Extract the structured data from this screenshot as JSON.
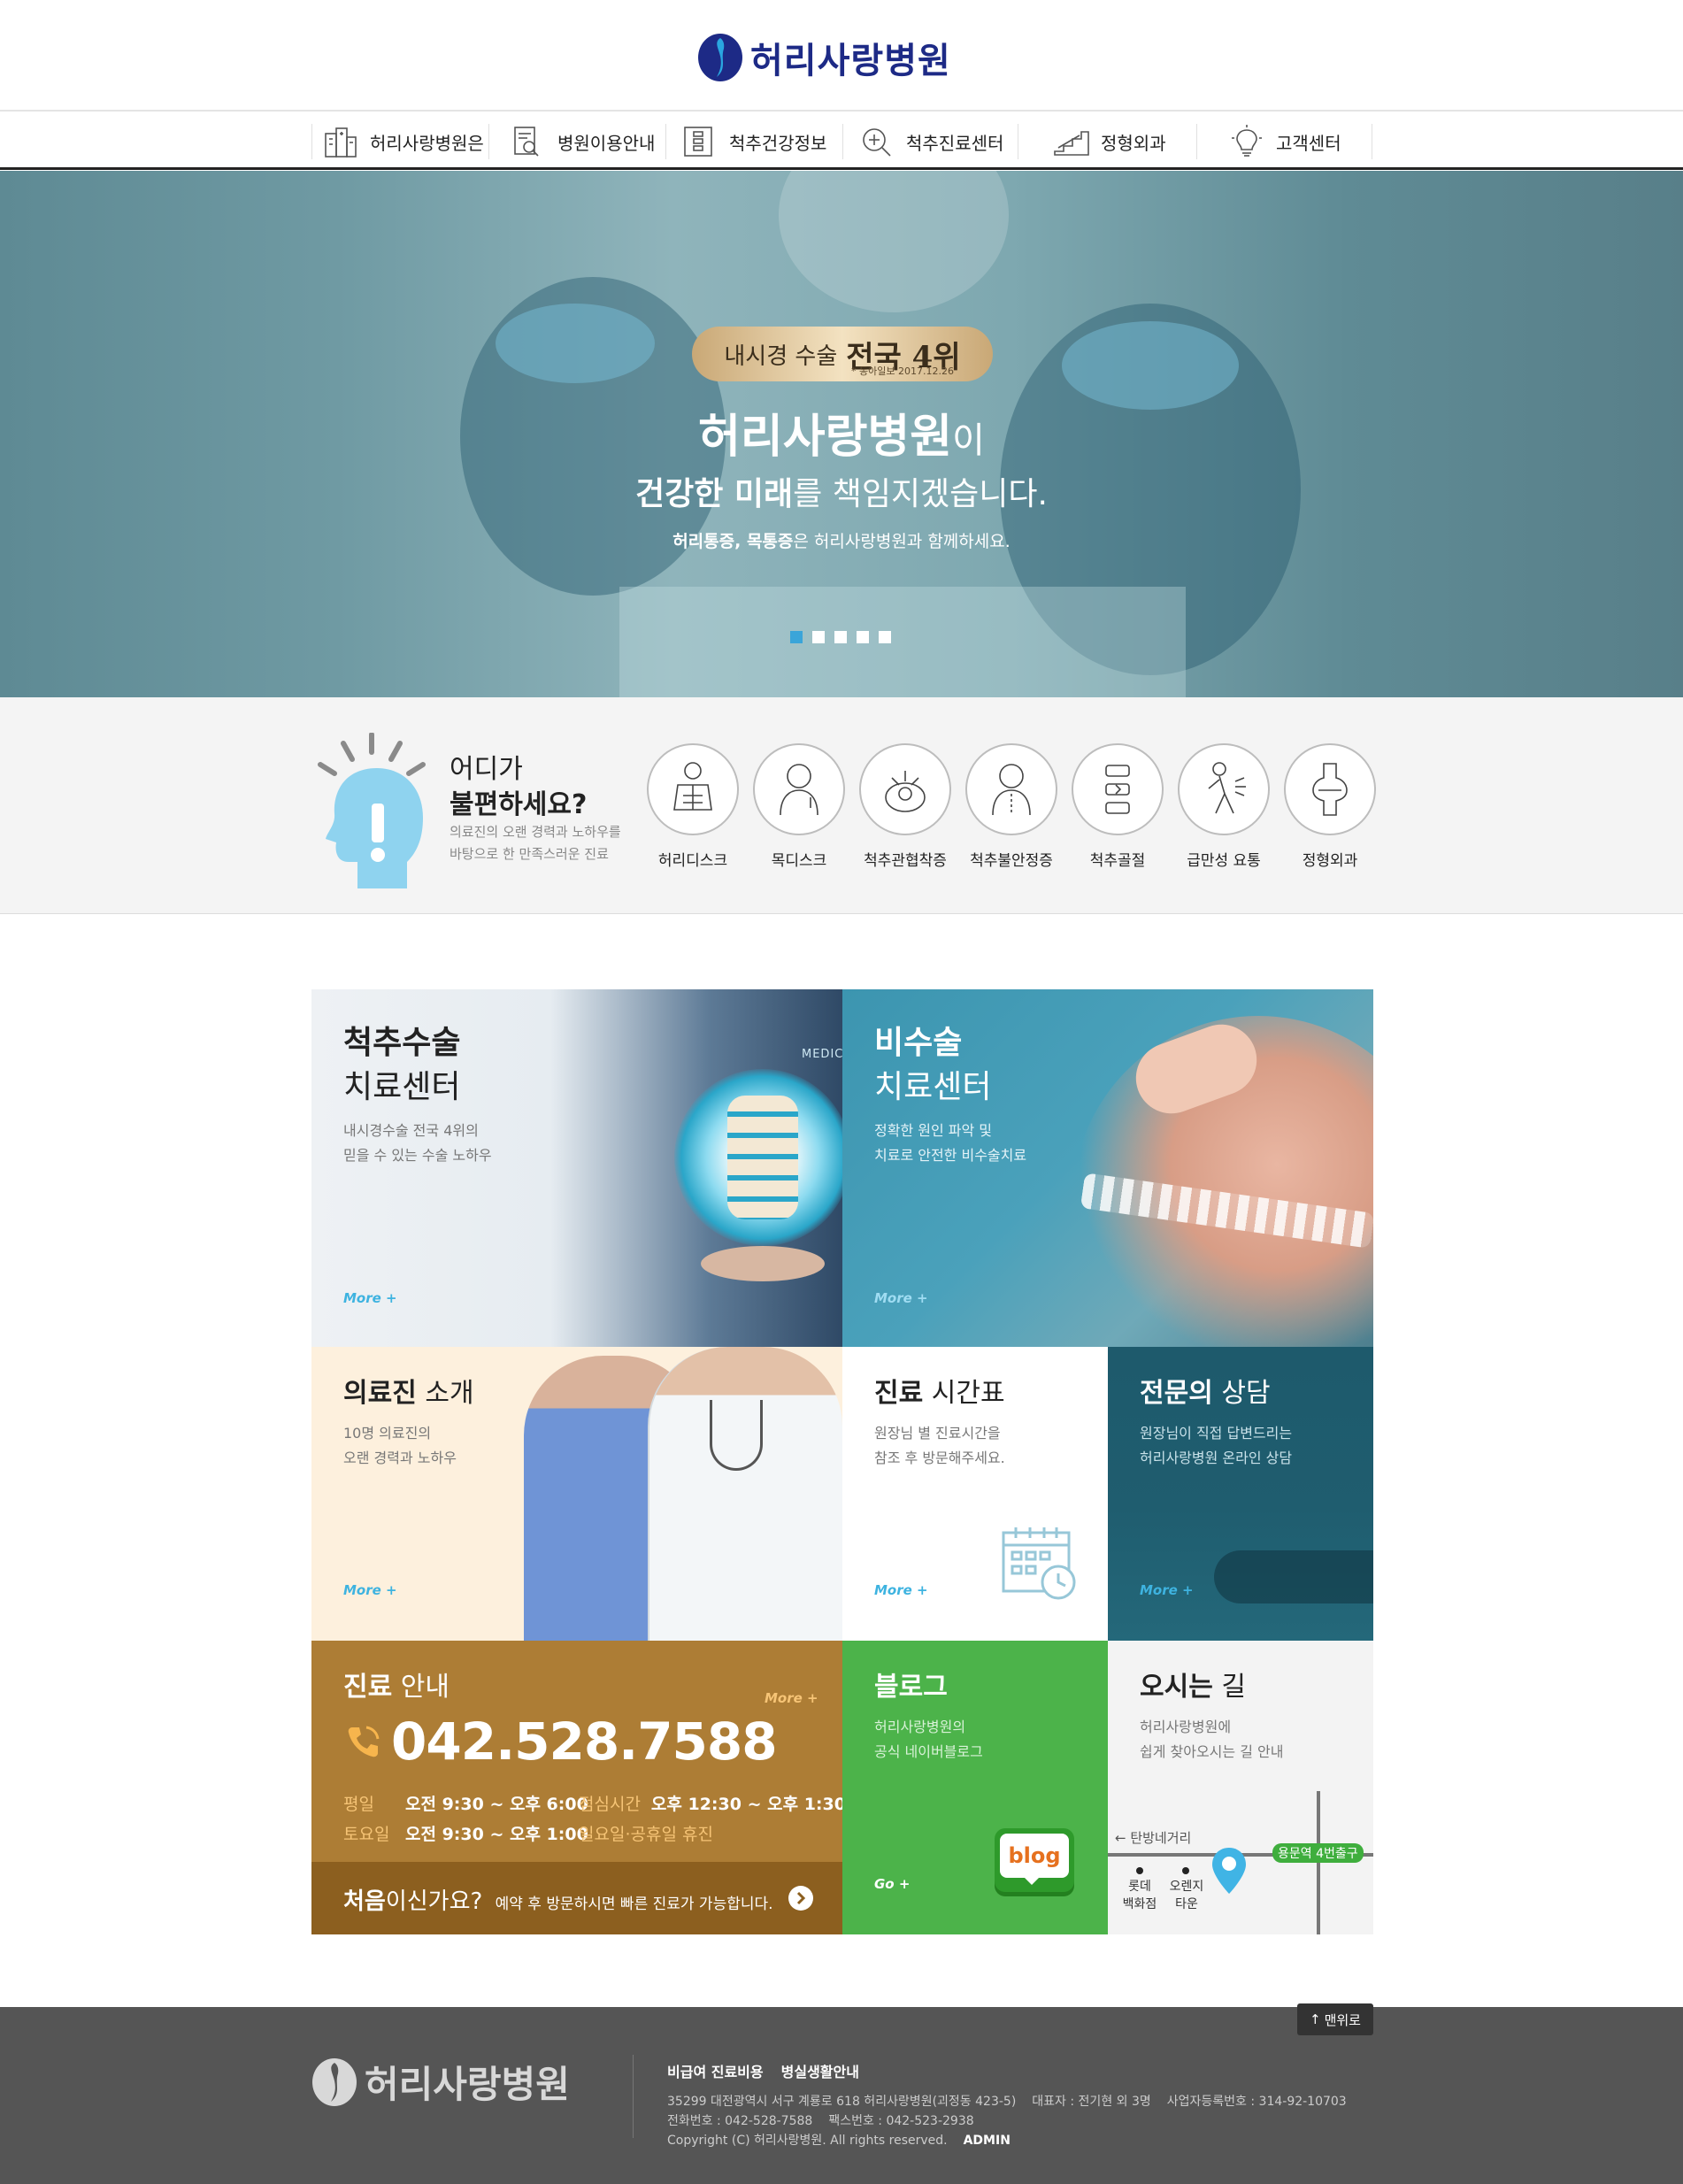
{
  "header": {
    "logo_text": "허리사랑병원",
    "nav": [
      {
        "label": "허리사랑병원은",
        "icon": "hospital-building-icon"
      },
      {
        "label": "병원이용안내",
        "icon": "document-search-icon"
      },
      {
        "label": "척추건강정보",
        "icon": "spine-info-icon"
      },
      {
        "label": "척추진료센터",
        "icon": "magnifier-plus-icon"
      },
      {
        "label": "정형외과",
        "icon": "stairs-icon"
      },
      {
        "label": "고객센터",
        "icon": "lightbulb-icon"
      }
    ]
  },
  "hero": {
    "badge_prefix": "내시경 수술",
    "badge_highlight": "전국 4위",
    "badge_source": "* 동아일보 2017.12.26",
    "title_bold": "허리사랑병원",
    "title_suffix": "이",
    "line2_bold": "건강한 미래",
    "line2_rest": "를 책임지겠습니다.",
    "line3_bold": "허리통증, 목통증",
    "line3_rest": "은 허리사랑병원과 함께하세요.",
    "slide_count": 5,
    "active_slide": 1
  },
  "symptoms": {
    "question_line1": "어디가",
    "question_line2": "불편하세요?",
    "desc_line1": "의료진의 오랜 경력과 노하우를",
    "desc_line2": "바탕으로 한 만족스러운 진료",
    "items": [
      {
        "label": "허리디스크"
      },
      {
        "label": "목디스크"
      },
      {
        "label": "척추관협착증"
      },
      {
        "label": "척추불안정증"
      },
      {
        "label": "척추골절"
      },
      {
        "label": "급만성 요통"
      },
      {
        "label": "정형외과"
      }
    ]
  },
  "tiles": {
    "surgery": {
      "title1": "척추수술",
      "title2": "치료센터",
      "desc1": "내시경수술 전국 4위의",
      "desc2": "믿을 수 있는 수술 노하우",
      "more": "More +",
      "tag": "MEDIC"
    },
    "nonsurgery": {
      "title1": "비수술",
      "title2": "치료센터",
      "desc1": "정확한 원인 파악 및",
      "desc2": "치료로 안전한 비수술치료",
      "more": "More +"
    },
    "doctors": {
      "title_bold": "의료진",
      "title_rest": " 소개",
      "desc1": "10명 의료진의",
      "desc2": "오랜 경력과 노하우",
      "more": "More +"
    },
    "schedule": {
      "title_bold": "진료",
      "title_rest": " 시간표",
      "desc1": "원장님 별 진료시간을",
      "desc2": "참조 후 방문해주세요.",
      "more": "More +"
    },
    "consult": {
      "title_bold": "전문의",
      "title_rest": " 상담",
      "desc1": "원장님이 직접 답변드리는",
      "desc2": "허리사랑병원 온라인 상담",
      "more": "More +"
    },
    "guide": {
      "title_bold": "진료",
      "title_rest": " 안내",
      "more": "More +",
      "phone": "042.528.7588",
      "weekday_label": "평일",
      "weekday_time": "오전 9:30 ~ 오후 6:00",
      "lunch_label": "점심시간",
      "lunch_time": "오후 12:30 ~ 오후 1:30",
      "saturday_label": "토요일",
      "saturday_time": "오전 9:30 ~ 오후 1:00",
      "holiday": "일요일·공휴일 휴진",
      "first_bold": "처음",
      "first_rest": "이신가요?",
      "first_desc": "예약 후 방문하시면 빠른 진료가 가능합니다."
    },
    "blog": {
      "title": "블로그",
      "desc1": "허리사랑병원의",
      "desc2": "공식 네이버블로그",
      "go": "Go +",
      "badge": "blog"
    },
    "directions": {
      "title_bold": "오시는",
      "title_rest": " 길",
      "desc1": "허리사랑병원에",
      "desc2": "쉽게 찾아오시는 길 안내",
      "map_intersection": "← 탄방네거리",
      "map_exit": "용문역 4번출구",
      "map_place1_a": "롯데",
      "map_place1_b": "백화점",
      "map_place2_a": "오렌지",
      "map_place2_b": "타운"
    }
  },
  "footer": {
    "top_button": "맨위로",
    "logo_text": "허리사랑병원",
    "links": [
      "비급여 진료비용",
      "병실생활안내"
    ],
    "address": "35299 대전광역시 서구 계룡로 618 허리사랑병원(괴정동 423-5)",
    "ceo": "대표자 : 전기현 외 3명",
    "biz_no": "사업자등록번호 : 314-92-10703",
    "tel": "전화번호 : 042-528-7588",
    "fax": "팩스번호 : 042-523-2938",
    "copyright": "Copyright (C) 허리사랑병원. All rights reserved.",
    "admin": "ADMIN"
  },
  "colors": {
    "brand_navy": "#1d2a86",
    "accent_blue": "#3eb3e0",
    "teal_tile": "#3a93ad",
    "dark_teal_tile": "#1e5c6e",
    "guide_brown": "#ad7d35",
    "blog_green": "#4cb34a",
    "footer_gray": "#555555"
  }
}
